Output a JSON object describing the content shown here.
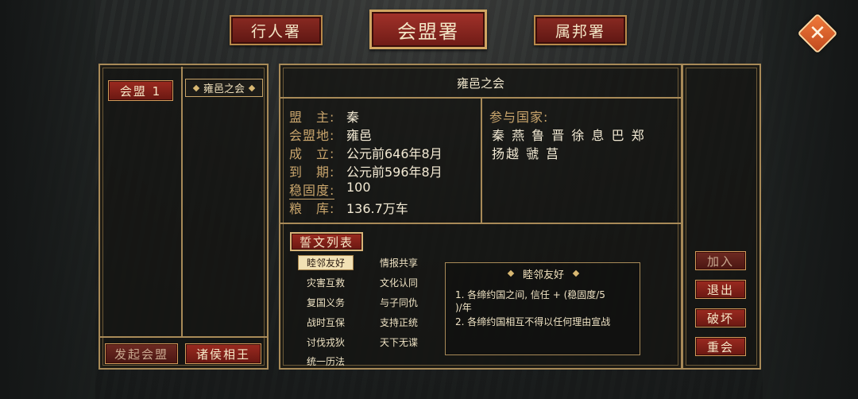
{
  "tabs": [
    {
      "label": "行人署",
      "active": false
    },
    {
      "label": "会盟署",
      "active": true
    },
    {
      "label": "属邦署",
      "active": false
    }
  ],
  "close": {
    "icon": "close-icon",
    "glyph": "✕"
  },
  "left": {
    "alliance_button": "会盟 1",
    "alliance_chip": "雍邑之会",
    "initiate_button": "发起会盟",
    "lords_button": "诸侯相王"
  },
  "info": {
    "title": "雍邑之会",
    "rows": [
      {
        "label": "盟　主:",
        "value": "秦"
      },
      {
        "label": "会盟地:",
        "value": "雍邑"
      },
      {
        "label": "成　立:",
        "value": "公元前646年8月"
      },
      {
        "label": "到　期:",
        "value": "公元前596年8月"
      },
      {
        "label": "稳固度:",
        "value": "100"
      },
      {
        "label": "粮　库:",
        "value": "136.7万车"
      }
    ],
    "participants_label": "参与国家:",
    "participants_line1": "秦 燕 鲁 晋 徐 息 巴 郑",
    "participants_line2": "扬越 虢 莒"
  },
  "treaty": {
    "heading": "誓文列表",
    "items": [
      {
        "label": "睦邻友好",
        "active": true
      },
      {
        "label": "情报共享",
        "active": false
      },
      {
        "label": "灾害互救",
        "active": false
      },
      {
        "label": "文化认同",
        "active": false
      },
      {
        "label": "复国义务",
        "active": false
      },
      {
        "label": "与子同仇",
        "active": false
      },
      {
        "label": "战时互保",
        "active": false
      },
      {
        "label": "支持正统",
        "active": false
      },
      {
        "label": "讨伐戎狄",
        "active": false
      },
      {
        "label": "天下无谍",
        "active": false
      },
      {
        "label": "统一历法",
        "active": false
      }
    ],
    "detail_title": "睦邻友好",
    "detail_lines": [
      "1. 各缔约国之间, 信任 + (稳固度/5",
      ")/年",
      "2. 各缔约国相互不得以任何理由宣战"
    ]
  },
  "actions": {
    "join": "加入",
    "leave": "退出",
    "break": "破坏",
    "resummit": "重会"
  }
}
